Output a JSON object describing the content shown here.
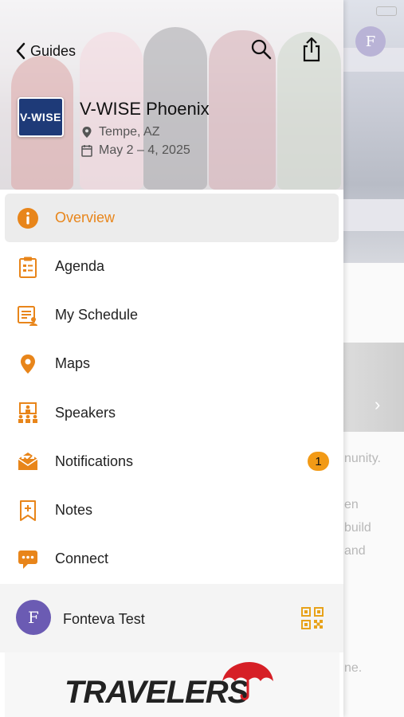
{
  "header": {
    "back_label": "Guides",
    "logo_text": "V-WISE",
    "event_title": "V-WISE Phoenix",
    "location": "Tempe, AZ",
    "dates": "May 2 – 4, 2025"
  },
  "menu": [
    {
      "label": "Overview",
      "icon": "info-icon",
      "active": true
    },
    {
      "label": "Agenda",
      "icon": "clipboard-icon"
    },
    {
      "label": "My Schedule",
      "icon": "schedule-icon"
    },
    {
      "label": "Maps",
      "icon": "map-pin-icon"
    },
    {
      "label": "Speakers",
      "icon": "speakers-icon"
    },
    {
      "label": "Notifications",
      "icon": "envelope-icon",
      "badge": "1"
    },
    {
      "label": "Notes",
      "icon": "bookmark-note-icon"
    },
    {
      "label": "Connect",
      "icon": "chat-bubble-icon"
    }
  ],
  "user": {
    "initial": "F",
    "name": "Fonteva Test"
  },
  "sponsor": {
    "name": "TRAVELERS"
  },
  "background": {
    "avatar_initial": "F",
    "text_fragments": [
      "nunity.",
      "en",
      "build",
      "and",
      "ne."
    ]
  },
  "colors": {
    "accent": "#e8851a",
    "badge": "#f29a16",
    "avatar": "#6b5bb3",
    "logo_bg": "#1e3a78",
    "umbrella": "#d61f26"
  }
}
